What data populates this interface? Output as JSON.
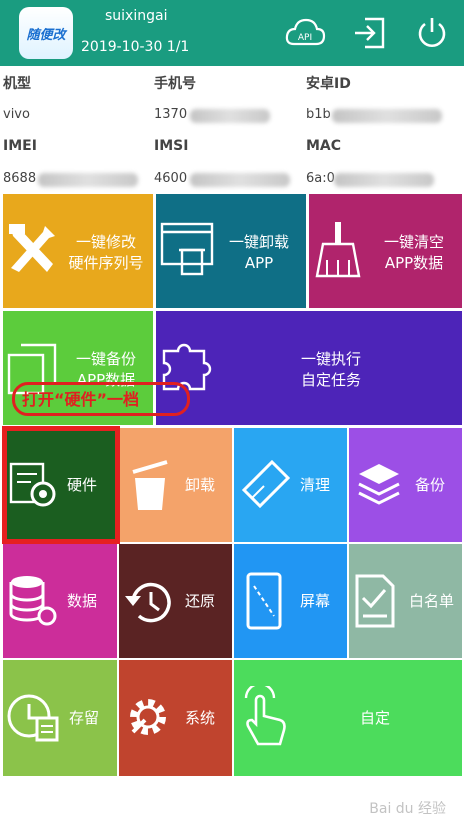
{
  "header": {
    "logo_text": "随便改",
    "username": "suixingai",
    "dateline": "2019-10-30 1/1",
    "api_label": "API"
  },
  "device": {
    "model_label": "机型",
    "model_value": "vivo",
    "phone_label": "手机号",
    "phone_value": "1370",
    "android_label": "安卓ID",
    "android_value": "b1b",
    "imei_label": "IMEI",
    "imei_value": "8688",
    "imsi_label": "IMSI",
    "imsi_value": "4600",
    "mac_label": "MAC",
    "mac_value": "6a:0"
  },
  "tiles": {
    "modify_serial": [
      "一键修改",
      "硬件序列号"
    ],
    "uninstall_app": [
      "一键卸载",
      "APP"
    ],
    "clear_app_data": [
      "一键清空",
      "APP数据"
    ],
    "backup_app_data": [
      "一键备份",
      "APP数据"
    ],
    "run_task": [
      "一键执行",
      "自定任务"
    ],
    "hardware": "硬件",
    "uninstall": "卸载",
    "clean": "清理",
    "backup": "备份",
    "data": "数据",
    "restore": "还原",
    "screen": "屏幕",
    "whitelist": "白名单",
    "storage": "存留",
    "system": "系统",
    "custom": "自定"
  },
  "annotation": "打开“硬件”一档",
  "watermark": "Bai du 经验",
  "colors": {
    "header": "#1a9c80",
    "orange": "#e8a81c",
    "teal": "#0f6f86",
    "magenta": "#b0246c",
    "green_light": "#5ccc3c",
    "purple": "#4d24b8",
    "dark_green": "#1b5e20",
    "peach": "#f4a36a",
    "sky": "#29a6f2",
    "violet": "#9c4fe6",
    "pink": "#cc2d9a",
    "maroon": "#5a2323",
    "blue": "#2196f3",
    "sage": "#8fb8a4",
    "lime": "#8bc34a",
    "red_brown": "#c0442e",
    "bright_green": "#4cdc5c"
  }
}
